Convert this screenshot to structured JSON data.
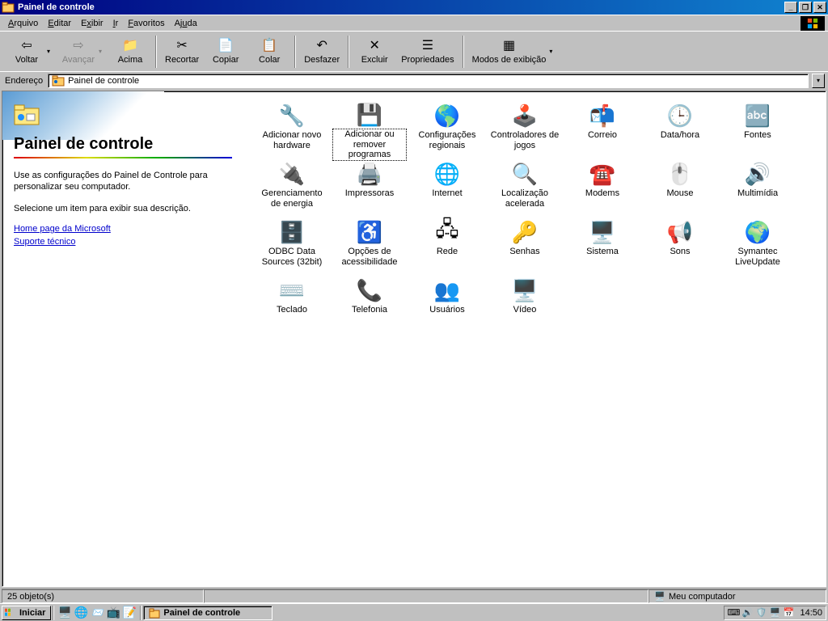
{
  "window": {
    "title": "Painel de controle",
    "minimize": "_",
    "maximize": "❐",
    "close": "✕"
  },
  "menu": {
    "items": [
      "Arquivo",
      "Editar",
      "Exibir",
      "Ir",
      "Favoritos",
      "Ajuda"
    ]
  },
  "toolbar": {
    "back": "Voltar",
    "forward": "Avançar",
    "up": "Acima",
    "cut": "Recortar",
    "copy": "Copiar",
    "paste": "Colar",
    "undo": "Desfazer",
    "delete": "Excluir",
    "properties": "Propriedades",
    "views": "Modos de exibição"
  },
  "address": {
    "label": "Endereço",
    "value": "Painel de controle"
  },
  "sidebar": {
    "title": "Painel de controle",
    "desc1": "Use as configurações do Painel de Controle para personalizar seu computador.",
    "desc2": "Selecione um item para exibir sua descrição.",
    "link1": "Home page da Microsoft",
    "link2": "Suporte técnico"
  },
  "icons": [
    {
      "name": "adicionar-novo-hardware",
      "label": "Adicionar novo hardware",
      "glyph": "🔧"
    },
    {
      "name": "adicionar-remover-programas",
      "label": "Adicionar ou remover programas",
      "glyph": "💾",
      "selected": true
    },
    {
      "name": "configuracoes-regionais",
      "label": "Configurações regionais",
      "glyph": "🌎"
    },
    {
      "name": "controladores-de-jogos",
      "label": "Controladores de jogos",
      "glyph": "🕹️"
    },
    {
      "name": "correio",
      "label": "Correio",
      "glyph": "📬"
    },
    {
      "name": "data-hora",
      "label": "Data/hora",
      "glyph": "🕒"
    },
    {
      "name": "fontes",
      "label": "Fontes",
      "glyph": "🔤"
    },
    {
      "name": "gerenciamento-de-energia",
      "label": "Gerenciamento de energia",
      "glyph": "🔌"
    },
    {
      "name": "impressoras",
      "label": "Impressoras",
      "glyph": "🖨️"
    },
    {
      "name": "internet",
      "label": "Internet",
      "glyph": "🌐"
    },
    {
      "name": "localizacao-acelerada",
      "label": "Localização acelerada",
      "glyph": "🔍"
    },
    {
      "name": "modems",
      "label": "Modems",
      "glyph": "☎️"
    },
    {
      "name": "mouse",
      "label": "Mouse",
      "glyph": "🖱️"
    },
    {
      "name": "multimidia",
      "label": "Multimídia",
      "glyph": "🔊"
    },
    {
      "name": "odbc-data-sources",
      "label": "ODBC Data Sources (32bit)",
      "glyph": "🗄️"
    },
    {
      "name": "opcoes-de-acessibilidade",
      "label": "Opções de acessibilidade",
      "glyph": "♿"
    },
    {
      "name": "rede",
      "label": "Rede",
      "glyph": "🖧"
    },
    {
      "name": "senhas",
      "label": "Senhas",
      "glyph": "🔑"
    },
    {
      "name": "sistema",
      "label": "Sistema",
      "glyph": "🖥️"
    },
    {
      "name": "sons",
      "label": "Sons",
      "glyph": "📢"
    },
    {
      "name": "symantec-liveupdate",
      "label": "Symantec LiveUpdate",
      "glyph": "🌍"
    },
    {
      "name": "teclado",
      "label": "Teclado",
      "glyph": "⌨️"
    },
    {
      "name": "telefonia",
      "label": "Telefonia",
      "glyph": "📞"
    },
    {
      "name": "usuarios",
      "label": "Usuários",
      "glyph": "👥"
    },
    {
      "name": "video",
      "label": "Vídeo",
      "glyph": "🖥️"
    }
  ],
  "status": {
    "left": "25 objeto(s)",
    "right": "Meu computador"
  },
  "taskbar": {
    "start": "Iniciar",
    "task": "Painel de controle",
    "clock": "14:50"
  }
}
